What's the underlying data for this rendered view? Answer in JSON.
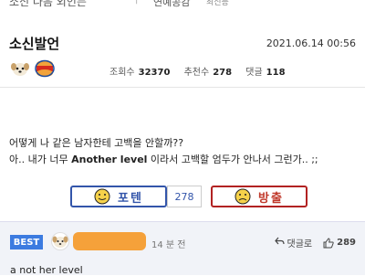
{
  "top_bar": {
    "title_fragment": "소신 다음 외인든",
    "separator": "|",
    "board": "연예공감",
    "sub": "최신등"
  },
  "post": {
    "title": "소신발언",
    "date": "2021.06.14 00:56",
    "stats": {
      "views_label": "조회수",
      "views": "32370",
      "recommend_label": "추천수",
      "recommend": "278",
      "comments_label": "댓글",
      "comments": "118"
    },
    "body_line1": "어떻게 나 같은 남자한테 고백을 안할까??",
    "body_line2_pre": "아.. 내가 너무 ",
    "body_line2_bold": "Another level",
    "body_line2_post": " 이라서 고백할 엄두가 안나서 그런가.. ;;"
  },
  "votes": {
    "up_label": "포텐",
    "count": "278",
    "down_label": "방출",
    "up_color": "#3355aa",
    "down_color": "#b22222"
  },
  "comment": {
    "badge": "BEST",
    "time": "14 분 전",
    "reply_label": "댓글로",
    "likes": "289",
    "text": "a not her level",
    "badge_color": "#3c7be0"
  }
}
